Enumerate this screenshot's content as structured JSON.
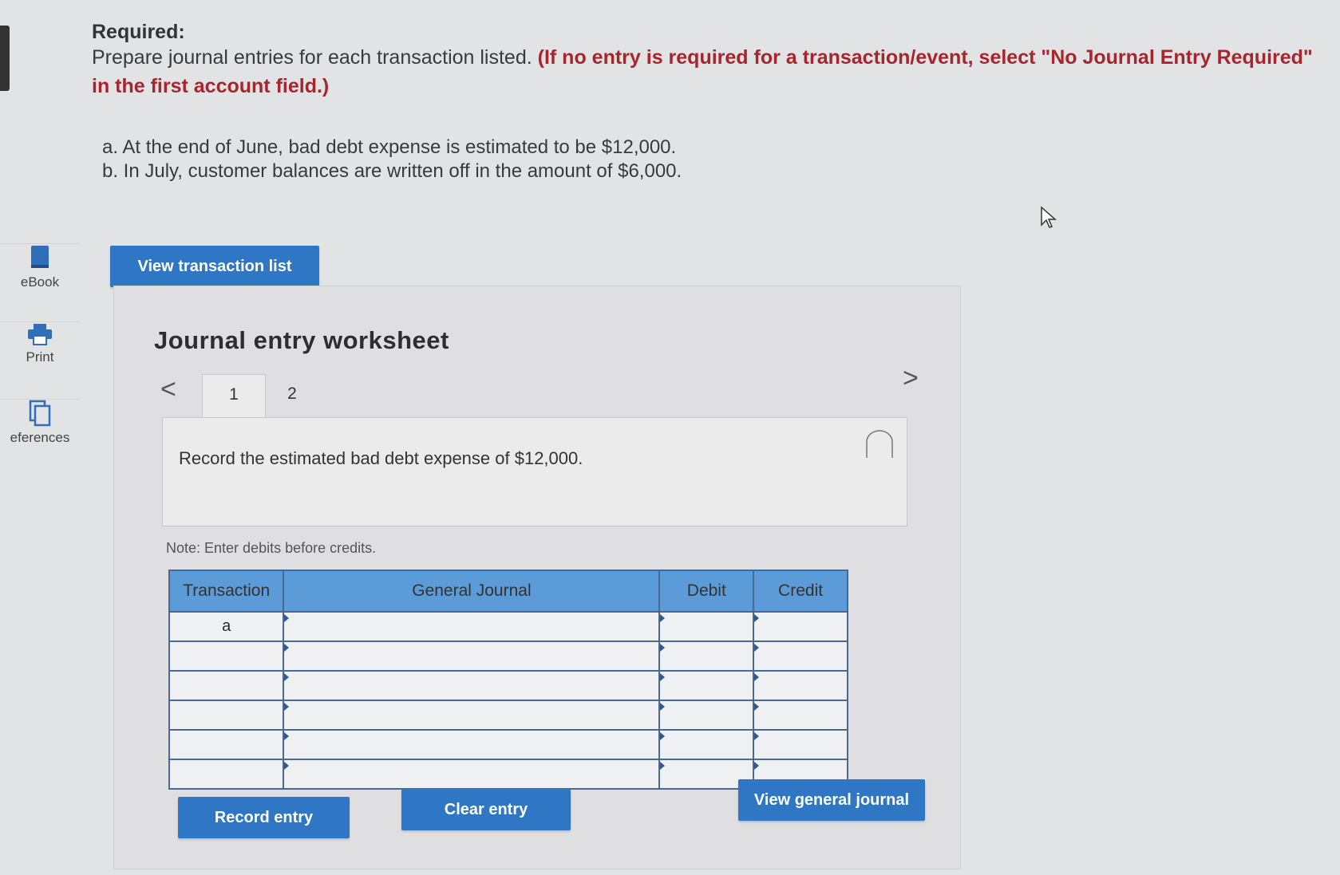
{
  "instructions": {
    "title": "Required:",
    "text": "Prepare journal entries for each transaction listed.",
    "highlight": "(If no entry is required for a transaction/event, select \"No Journal Entry Required\" in the first account field.)"
  },
  "transactions": [
    "a. At the end of June, bad debt expense is estimated to be $12,000.",
    "b. In July, customer balances are written off in the amount of $6,000."
  ],
  "sidebar": {
    "items": [
      {
        "label": "eBook",
        "icon": "book-icon"
      },
      {
        "label": "Print",
        "icon": "printer-icon"
      },
      {
        "label": "eferences",
        "icon": "references-icon"
      }
    ]
  },
  "buttons": {
    "view_transactions": "View transaction list",
    "record_entry": "Record entry",
    "clear_entry": "Clear entry",
    "view_general_journal": "View general journal"
  },
  "worksheet": {
    "title": "Journal entry worksheet",
    "prev": "<",
    "next": ">",
    "tabs": [
      "1",
      "2"
    ],
    "active_tab": "1",
    "instruction": "Record the estimated bad debt expense of $12,000.",
    "note": "Note: Enter debits before credits."
  },
  "journal_table": {
    "headers": {
      "transaction": "Transaction",
      "account": "General Journal",
      "debit": "Debit",
      "credit": "Credit"
    },
    "rows": [
      {
        "transaction": "a",
        "account": "",
        "debit": "",
        "credit": ""
      },
      {
        "transaction": "",
        "account": "",
        "debit": "",
        "credit": ""
      },
      {
        "transaction": "",
        "account": "",
        "debit": "",
        "credit": ""
      },
      {
        "transaction": "",
        "account": "",
        "debit": "",
        "credit": ""
      },
      {
        "transaction": "",
        "account": "",
        "debit": "",
        "credit": ""
      },
      {
        "transaction": "",
        "account": "",
        "debit": "",
        "credit": ""
      }
    ]
  },
  "colors": {
    "button_blue": "#2f76c5",
    "header_blue": "#5b9bd8",
    "highlight_red": "#a8252e"
  }
}
